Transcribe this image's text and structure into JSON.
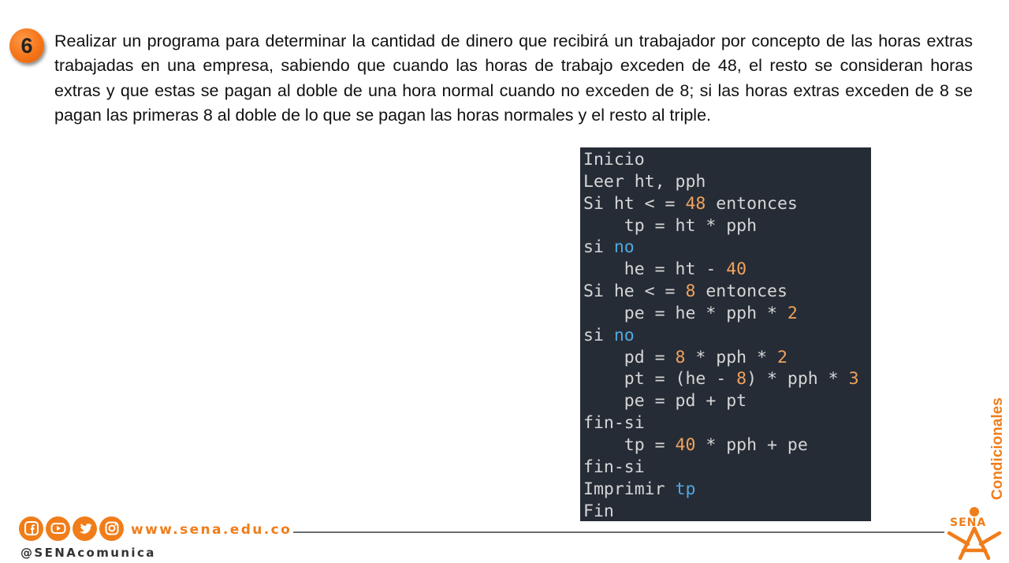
{
  "exercise": {
    "number": "6",
    "statement": "Realizar un programa para determinar la cantidad de dinero que recibirá un trabajador por concepto de las horas extras trabajadas en una empresa, sabiendo que cuando las horas de trabajo exceden de 48, el resto se consideran horas extras y que estas se pagan al doble de una hora normal cuando no exceden de 8; si las horas extras exceden de 8 se pagan las primeras 8 al doble de lo que se pagan las horas normales y el resto al triple."
  },
  "code": {
    "lines": [
      [
        {
          "t": "Inicio"
        }
      ],
      [
        {
          "t": "Leer ht, pph"
        }
      ],
      [
        {
          "t": "Si ht < = "
        },
        {
          "t": "48",
          "c": "num"
        },
        {
          "t": " entonces"
        }
      ],
      [
        {
          "t": "    tp = ht * pph"
        }
      ],
      [
        {
          "t": "si "
        },
        {
          "t": "no",
          "c": "kw"
        }
      ],
      [
        {
          "t": "    he = ht - "
        },
        {
          "t": "40",
          "c": "num"
        }
      ],
      [
        {
          "t": "Si he < = "
        },
        {
          "t": "8",
          "c": "num"
        },
        {
          "t": " entonces"
        }
      ],
      [
        {
          "t": "    pe = he * pph * "
        },
        {
          "t": "2",
          "c": "num"
        }
      ],
      [
        {
          "t": "si "
        },
        {
          "t": "no",
          "c": "kw"
        }
      ],
      [
        {
          "t": "    pd = "
        },
        {
          "t": "8",
          "c": "num"
        },
        {
          "t": " * pph * "
        },
        {
          "t": "2",
          "c": "num"
        }
      ],
      [
        {
          "t": "    pt = (he - "
        },
        {
          "t": "8",
          "c": "num"
        },
        {
          "t": ") * pph * "
        },
        {
          "t": "3",
          "c": "num"
        }
      ],
      [
        {
          "t": "    pe = pd + pt"
        }
      ],
      [
        {
          "t": "fin-si"
        }
      ],
      [
        {
          "t": "    tp = "
        },
        {
          "t": "40",
          "c": "num"
        },
        {
          "t": " * pph + pe"
        }
      ],
      [
        {
          "t": "fin-si"
        }
      ],
      [
        {
          "t": "Imprimir "
        },
        {
          "t": "tp",
          "c": "kw"
        }
      ],
      [
        {
          "t": "Fin"
        }
      ]
    ],
    "colors": {
      "background": "#262c36",
      "text": "#d6d6d6",
      "number": "#f0a35c",
      "keyword": "#52a8e0"
    }
  },
  "side_label": "Condicionales",
  "footer": {
    "website": "www.sena.edu.co",
    "handle": "@SENAcomunica",
    "social_icons": [
      "facebook-icon",
      "youtube-icon",
      "twitter-icon",
      "instagram-icon"
    ],
    "brand_color": "#f07d1a"
  },
  "logo": {
    "text": "SENA"
  }
}
